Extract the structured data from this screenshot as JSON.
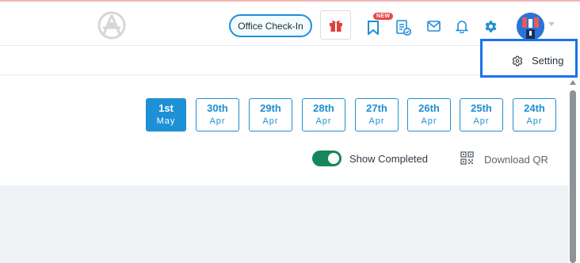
{
  "header": {
    "office_checkin_label": "Office Check-In",
    "new_badge": "NEW"
  },
  "settings_dropdown": {
    "label": "Setting"
  },
  "dates": [
    {
      "day": "1st",
      "month": "May",
      "active": true
    },
    {
      "day": "30th",
      "month": "Apr",
      "active": false
    },
    {
      "day": "29th",
      "month": "Apr",
      "active": false
    },
    {
      "day": "28th",
      "month": "Apr",
      "active": false
    },
    {
      "day": "27th",
      "month": "Apr",
      "active": false
    },
    {
      "day": "26th",
      "month": "Apr",
      "active": false
    },
    {
      "day": "25th",
      "month": "Apr",
      "active": false
    },
    {
      "day": "24th",
      "month": "Apr",
      "active": false
    }
  ],
  "controls": {
    "show_completed_label": "Show Completed",
    "show_completed_on": true,
    "download_qr_label": "Download QR"
  },
  "colors": {
    "accent": "#1e90d6",
    "toggle_on": "#14885b",
    "highlight_border": "#1a73e8",
    "gift_red": "#e0403f"
  },
  "icons": [
    "logo-icon",
    "gift-icon",
    "bookmark-new-icon",
    "task-list-icon",
    "mail-icon",
    "bell-icon",
    "gear-icon",
    "avatar",
    "qr-code-icon"
  ]
}
